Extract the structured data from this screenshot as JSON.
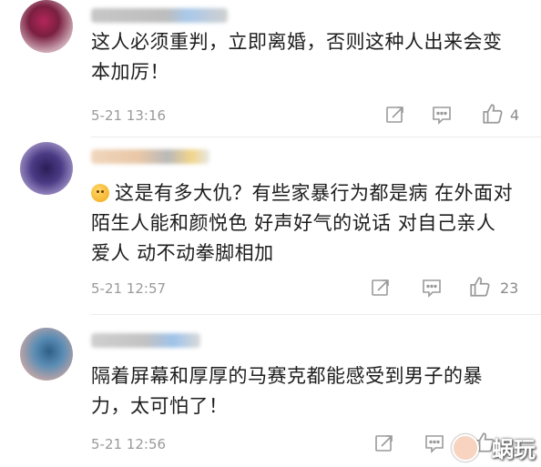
{
  "comments": [
    {
      "text": "这人必须重判，立即离婚，否则这种人出来会变本加厉！",
      "time": "5-21 13:16",
      "likes": "4"
    },
    {
      "text": "这是有多大仇？有些家暴行为都是病 在外面对陌生人能和颜悦色 好声好气的说话 对自己亲人 爱人 动不动拳脚相加",
      "time": "5-21 12:57",
      "likes": "23"
    },
    {
      "text": "隔着屏幕和厚厚的马赛克都能感受到男子的暴力，太可怕了！",
      "time": "5-21 12:56",
      "likes": ""
    }
  ],
  "watermark": "蜗玩",
  "icons": [
    "share-icon",
    "comment-icon",
    "like-icon"
  ]
}
